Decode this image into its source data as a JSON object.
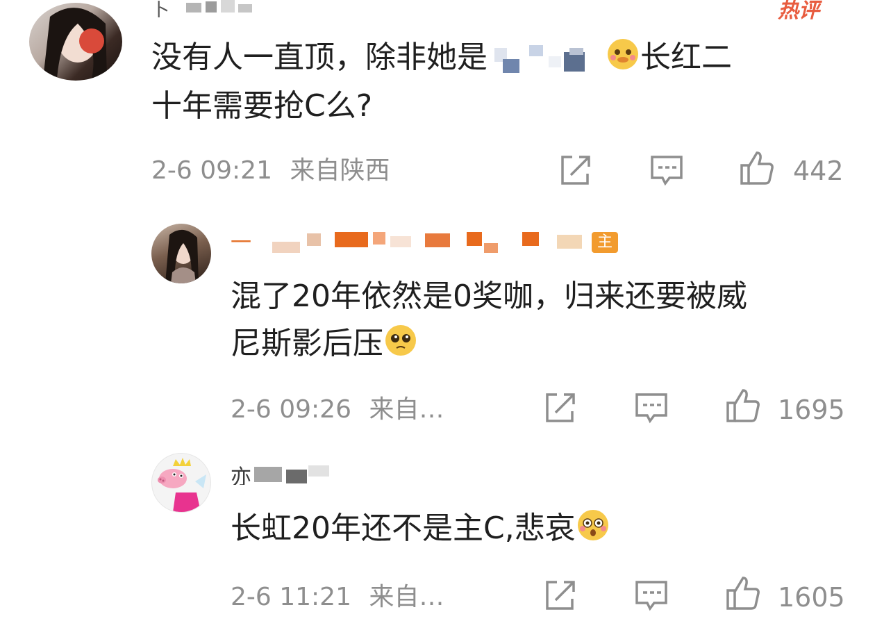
{
  "comments": [
    {
      "username": "卜",
      "text_line1": "没有人一直顶，除非她是",
      "text_line2_prefix": "长红二",
      "text_line3": "十年需要抢C么?",
      "time": "2-6 09:21",
      "location": "来自陕西",
      "likes": "442",
      "hot_badge": "热评",
      "emoji": "pleading-face"
    },
    {
      "username": "一",
      "author_badge": "主",
      "text_line1": "混了20年依然是0奖咖，归来还要被威",
      "text_line2": "尼斯影后压",
      "time": "2-6 09:26",
      "location": "来自…",
      "likes": "1695",
      "emoji": "pleading-face"
    },
    {
      "username": "亦",
      "text_line1": "长虹20年还不是主C,悲哀",
      "time": "2-6 11:21",
      "location": "来自…",
      "likes": "1605",
      "emoji": "flushed-face"
    }
  ],
  "icons": {
    "share": "share-icon",
    "reply": "comment-icon",
    "like": "thumbs-up-icon"
  },
  "colors": {
    "meta_gray": "#8e8e8e",
    "hot_red": "#e85c3f",
    "badge_orange": "#f29b2e"
  }
}
